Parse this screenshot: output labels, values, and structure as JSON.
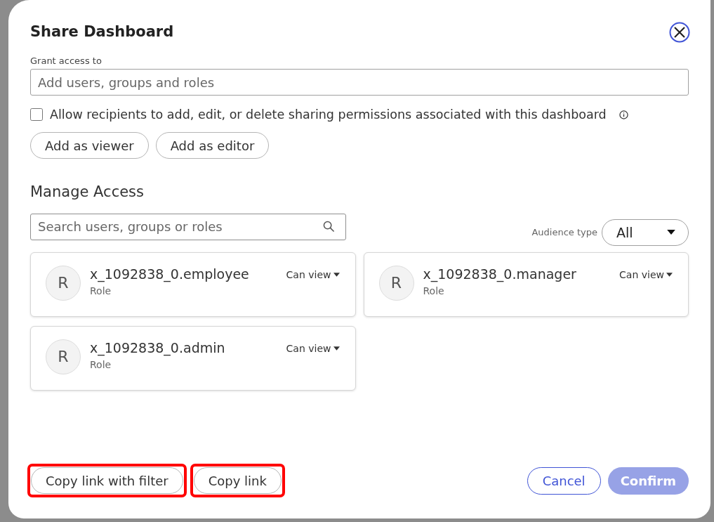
{
  "dialog": {
    "title": "Share Dashboard"
  },
  "grant": {
    "label": "Grant access to",
    "placeholder": "Add users, groups and roles"
  },
  "permission_option": {
    "label": "Allow recipients to add, edit, or delete sharing permissions associated with this dashboard",
    "checked": false
  },
  "add_buttons": [
    "Add as viewer",
    "Add as editor"
  ],
  "manage": {
    "title": "Manage Access",
    "search_placeholder": "Search users, groups or roles",
    "audience_label": "Audience type",
    "audience_value": "All"
  },
  "members": [
    {
      "initial": "R",
      "name": "x_1092838_0.employee",
      "type": "Role",
      "access": "Can view"
    },
    {
      "initial": "R",
      "name": "x_1092838_0.manager",
      "type": "Role",
      "access": "Can view"
    },
    {
      "initial": "R",
      "name": "x_1092838_0.admin",
      "type": "Role",
      "access": "Can view"
    }
  ],
  "footer": {
    "left_buttons": [
      {
        "label": "Copy link with filter",
        "highlighted": true
      },
      {
        "label": "Copy link",
        "highlighted": true
      }
    ],
    "cancel": "Cancel",
    "confirm": {
      "label": "Confirm",
      "disabled": true
    }
  }
}
